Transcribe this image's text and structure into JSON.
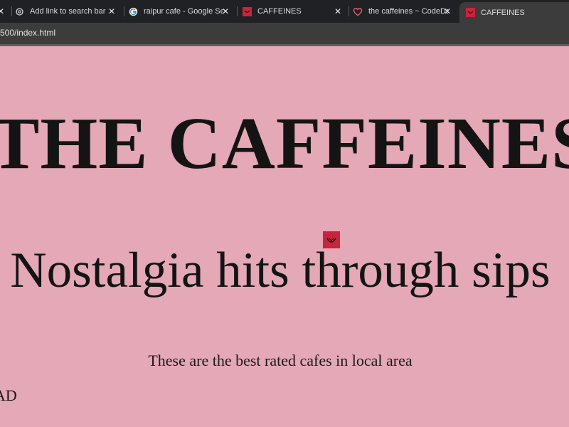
{
  "browser": {
    "tabs": [
      {
        "title": "",
        "icon": "close-icon"
      },
      {
        "title": "Add link to search bar",
        "icon": "openai-icon"
      },
      {
        "title": "raipur cafe - Google Search",
        "icon": "google-icon"
      },
      {
        "title": "CAFFEINES",
        "icon": "caffeines-logo-icon"
      },
      {
        "title": "the caffeines ~ CodeDay Sh",
        "icon": "heart-icon"
      },
      {
        "title": "CAFFEINES",
        "icon": "caffeines-logo-icon"
      }
    ],
    "close_symbol": "✕",
    "url": "500/index.html"
  },
  "page": {
    "title": "THE CAFFEINES",
    "tagline": "Nostalgia hits through sips",
    "subtitle": "These are the best rated cafes in local area",
    "partial_text": "AD"
  },
  "colors": {
    "background": "#e4a8b6",
    "accent": "#c8243b",
    "tabbar": "#202124"
  }
}
